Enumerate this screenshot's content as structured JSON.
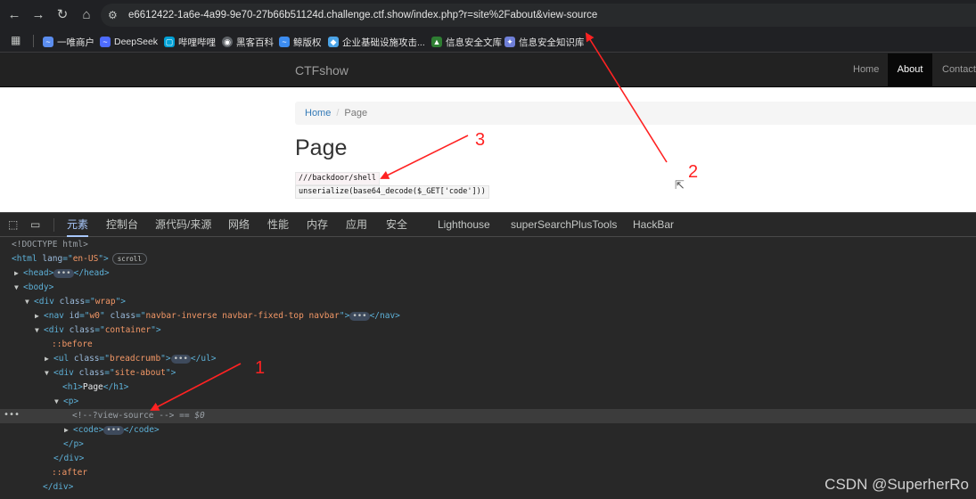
{
  "browser": {
    "url": "e6612422-1a6e-4a99-9e70-27b66b51124d.challenge.ctf.show/index.php?r=site%2Fabout&view-source",
    "bookmarks": [
      {
        "label": "一唯商户",
        "icon": "antchain-icon",
        "color": "#5b8def"
      },
      {
        "label": "DeepSeek",
        "icon": "deepseek-whale-icon",
        "color": "#4d6bfe"
      },
      {
        "label": "哔哩哔哩",
        "icon": "bilibili-tv-icon",
        "color": "#00a1d6"
      },
      {
        "label": "黑客百科",
        "icon": "globe-icon",
        "color": "#9aa0a6"
      },
      {
        "label": "鲸版权",
        "icon": "whale-icon",
        "color": "#3c8cf0"
      },
      {
        "label": "企业基础设施攻击...",
        "icon": "cube-icon",
        "color": "#4ba3e6"
      },
      {
        "label": "信息安全文库",
        "icon": "shield-icon",
        "color": "#2e7d32"
      },
      {
        "label": "信息安全知识库",
        "icon": "badge-icon",
        "color": "#6f7fd8"
      }
    ]
  },
  "site": {
    "brand": "CTFshow",
    "nav": [
      {
        "label": "Home",
        "active": false
      },
      {
        "label": "About",
        "active": true
      },
      {
        "label": "Contact",
        "active": false
      }
    ],
    "breadcrumb": {
      "home": "Home",
      "separator": "/",
      "current": "Page"
    },
    "heading": "Page",
    "comment_code": "///backdoor/shell",
    "php_code": "unserialize(base64_decode($_GET['code']))"
  },
  "devtools": {
    "tabs": [
      {
        "label": "元素",
        "active": true
      },
      {
        "label": "控制台",
        "active": false
      },
      {
        "label": "源代码/来源",
        "active": false
      },
      {
        "label": "网络",
        "active": false
      },
      {
        "label": "性能",
        "active": false
      },
      {
        "label": "内存",
        "active": false
      },
      {
        "label": "应用",
        "active": false
      },
      {
        "label": "安全",
        "active": false
      },
      {
        "label": "Lighthouse",
        "active": false
      },
      {
        "label": "superSearchPlusTools",
        "active": false
      },
      {
        "label": "HackBar",
        "active": false
      }
    ],
    "dom": {
      "doctype": "<!DOCTYPE html>",
      "html_lang": "en-US",
      "scroll_badge": "scroll",
      "nav_id": "w0",
      "nav_class": "navbar-inverse navbar-fixed-top navbar",
      "wrap_class": "wrap",
      "container_class": "container",
      "before": "::before",
      "after": "::after",
      "ul_class": "breadcrumb",
      "site_about_class": "site-about",
      "h1_text": "Page",
      "comment": "<!--?view-source -->",
      "eq": "==",
      "dollar": "$0"
    }
  },
  "annotations": [
    "1",
    "2",
    "3"
  ],
  "watermark": "CSDN @SuperherRo",
  "colors": {
    "annotation_red": "#ff2222",
    "navbar_bg": "#222222",
    "link_blue": "#337ab7",
    "devtools_bg": "#282828"
  }
}
